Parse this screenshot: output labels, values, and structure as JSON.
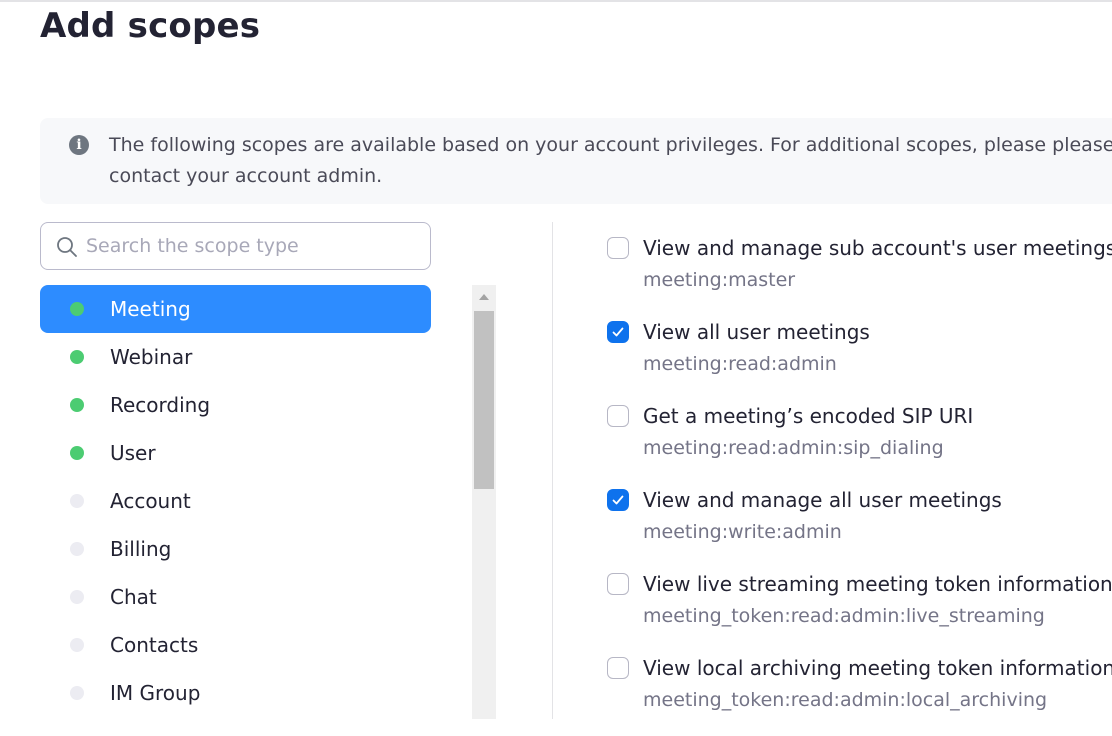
{
  "page": {
    "title": "Add scopes"
  },
  "info": {
    "icon": "info-icon",
    "text": "The following scopes are available based on your account privileges. For additional scopes, please please contact your account admin."
  },
  "search": {
    "placeholder": "Search the scope type",
    "value": ""
  },
  "colors": {
    "accent": "#2d8cff",
    "checkbox": "#0e72ed",
    "enabled_dot": "#4ccc72",
    "disabled_dot": "#ececf2"
  },
  "categories": [
    {
      "label": "Meeting",
      "enabled": true,
      "active": true
    },
    {
      "label": "Webinar",
      "enabled": true,
      "active": false
    },
    {
      "label": "Recording",
      "enabled": true,
      "active": false
    },
    {
      "label": "User",
      "enabled": true,
      "active": false
    },
    {
      "label": "Account",
      "enabled": false,
      "active": false
    },
    {
      "label": "Billing",
      "enabled": false,
      "active": false
    },
    {
      "label": "Chat",
      "enabled": false,
      "active": false
    },
    {
      "label": "Contacts",
      "enabled": false,
      "active": false
    },
    {
      "label": "IM Group",
      "enabled": false,
      "active": false
    }
  ],
  "scopes": [
    {
      "name": "View and manage sub account's user meetings",
      "key": "meeting:master",
      "checked": false
    },
    {
      "name": "View all user meetings",
      "key": "meeting:read:admin",
      "checked": true
    },
    {
      "name": "Get a meeting’s encoded SIP URI",
      "key": "meeting:read:admin:sip_dialing",
      "checked": false
    },
    {
      "name": "View and manage all user meetings",
      "key": "meeting:write:admin",
      "checked": true
    },
    {
      "name": "View live streaming meeting token information",
      "key": "meeting_token:read:admin:live_streaming",
      "checked": false
    },
    {
      "name": "View local archiving meeting token information",
      "key": "meeting_token:read:admin:local_archiving",
      "checked": false
    }
  ]
}
